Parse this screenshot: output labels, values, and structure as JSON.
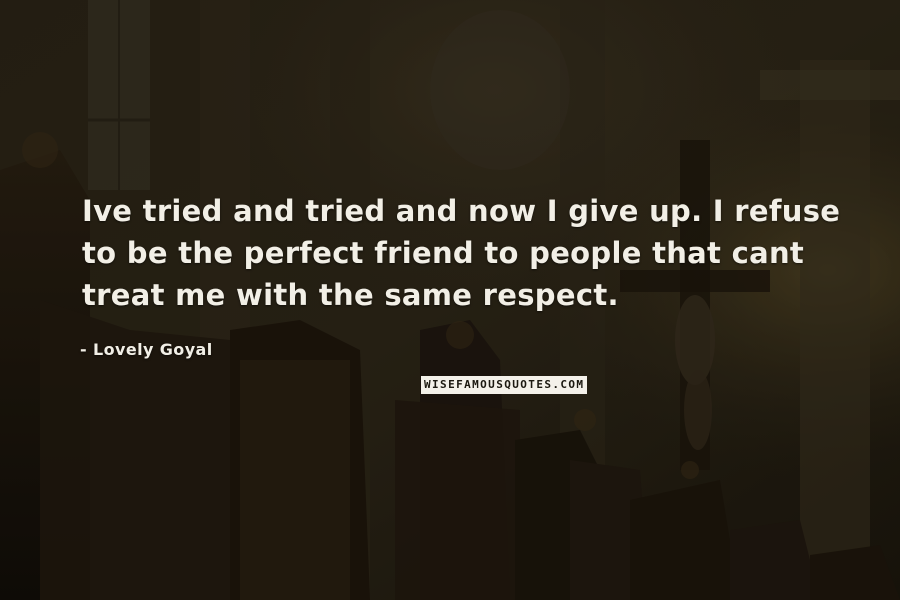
{
  "quote": {
    "text": "Ive tried and tried and now I give up. I refuse to be the perfect friend to people that cant treat me with the same respect."
  },
  "author": {
    "text": "- Lovely Goyal"
  },
  "watermark": {
    "text": "WISEFAMOUSQUOTES.COM"
  },
  "background": {
    "subject": "church interior with wooden pews and crucifix",
    "tone_color": "#2a2316"
  },
  "text_color": "#f2efe6"
}
